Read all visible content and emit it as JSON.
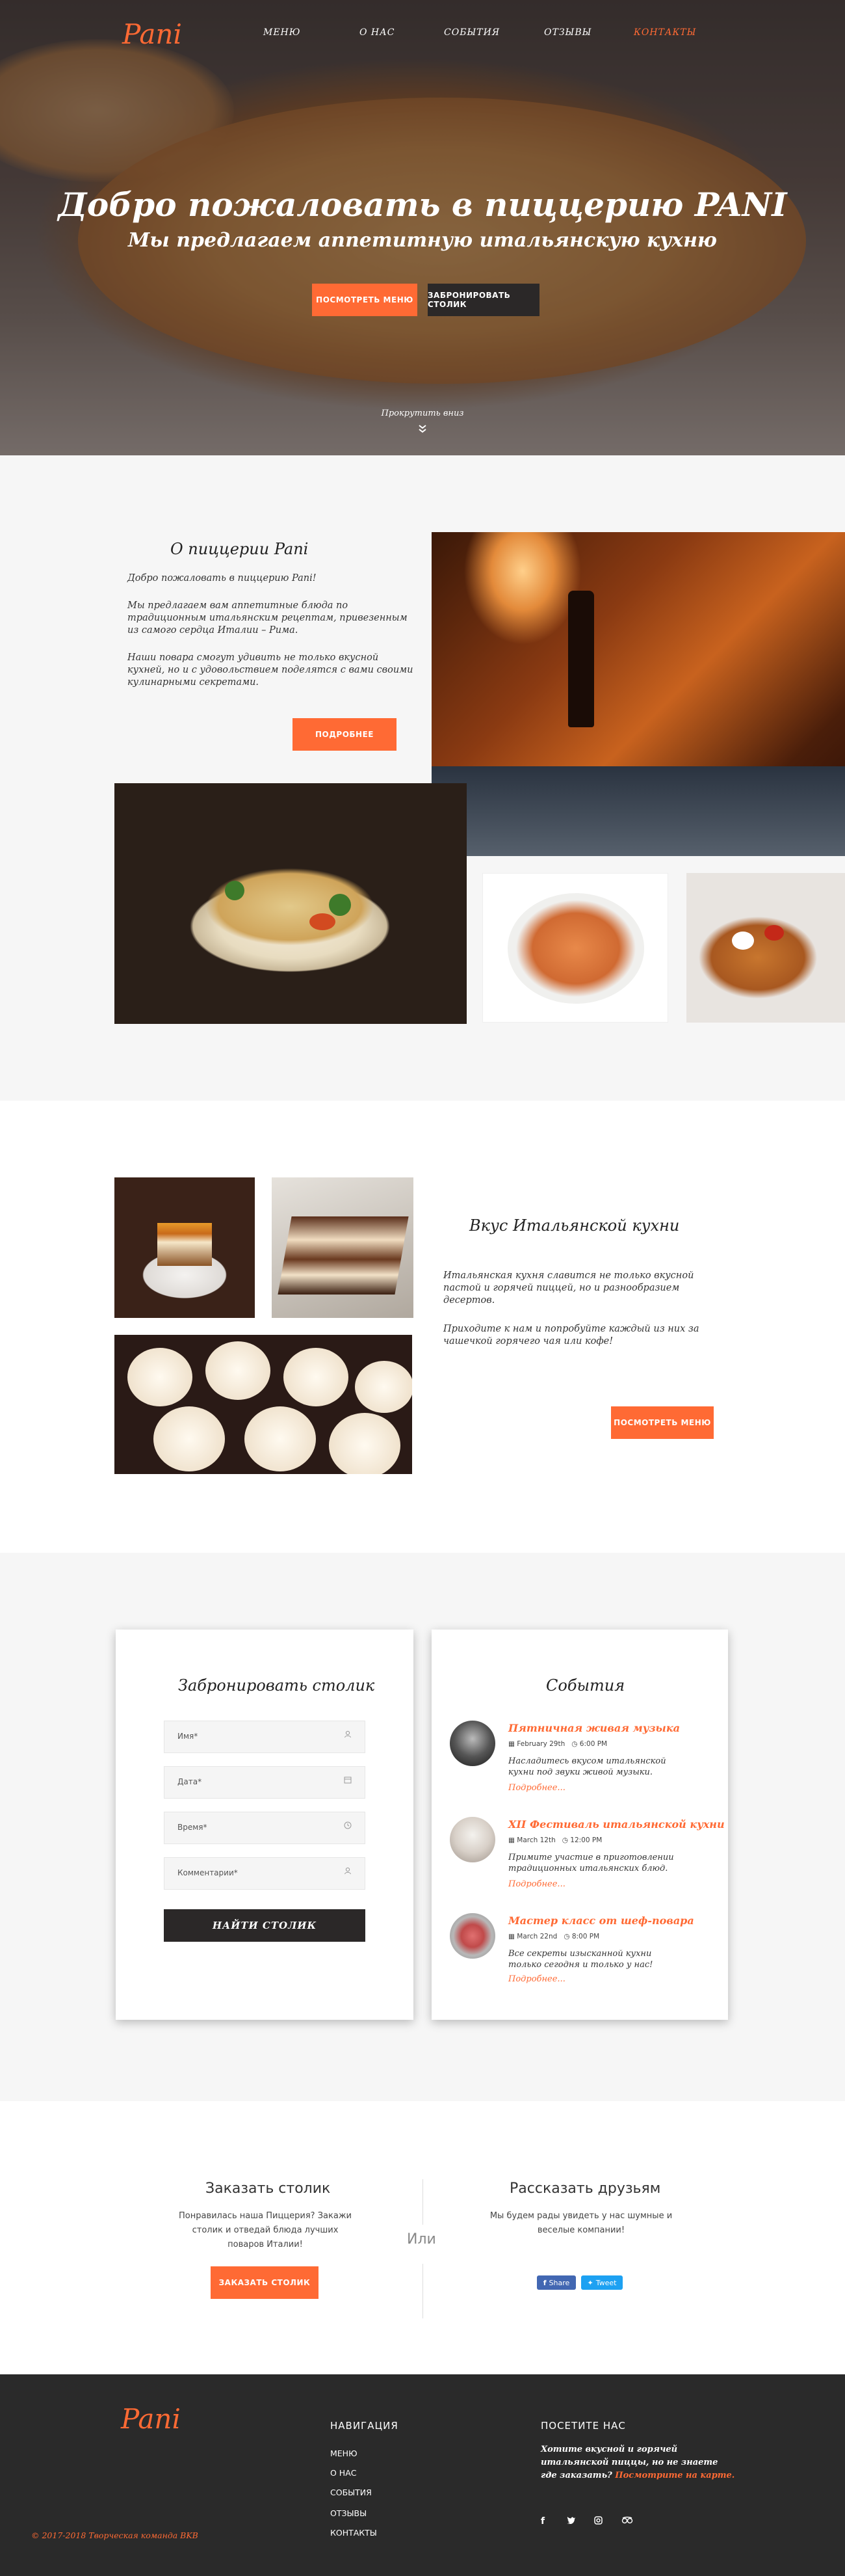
{
  "brand": {
    "logo": "Pani",
    "accent": "#ff6a34",
    "dark": "#2b2828"
  },
  "nav": {
    "items": [
      "МЕНЮ",
      "О НАС",
      "СОБЫТИЯ",
      "ОТЗЫВЫ",
      "КОНТАКТЫ"
    ]
  },
  "hero": {
    "title": "Добро пожаловать в пиццерию PANI",
    "subtitle": "Мы предлагаем аппетитную итальянскую кухню",
    "menu_button": "ПОСМОТРЕТЬ МЕНЮ",
    "book_button": "ЗАБРОНИРОВАТЬ СТОЛИК",
    "scroll": "Прокрутить вниз"
  },
  "about": {
    "title": "О пиццерии Pani",
    "p1": "Добро пожаловать в пиццерию Pani!",
    "p2": "Мы предлагаем вам аппетитные блюда по традиционным итальянским рецептам, привезенным из самого сердца Италии – Рима.",
    "p3": "Наши повара смогут удивить не только вкусной кухней, но и с удовольствием поделятся с вами своими кулинарными секретами.",
    "button": "ПОДРОБНЕЕ"
  },
  "dessert": {
    "title": "Вкус Итальянской кухни",
    "p1": "Итальянская кухня славится не только вкусной пастой и горячей пиццей, но и разнообразием десертов.",
    "p2": "Приходите к нам и попробуйте каждый из них за чашечкой горячего чая или кофе!",
    "button": "ПОСМОТРЕТЬ МЕНЮ"
  },
  "booking": {
    "title": "Забронировать столик",
    "fields": [
      {
        "placeholder": "Имя*",
        "icon": "user-icon"
      },
      {
        "placeholder": "Дата*",
        "icon": "calendar-icon"
      },
      {
        "placeholder": "Время*",
        "icon": "clock-icon"
      },
      {
        "placeholder": "Комментарии*",
        "icon": "user-icon"
      }
    ],
    "submit": "НАЙТИ СТОЛИК"
  },
  "events": {
    "title": "События",
    "items": [
      {
        "title": "Пятничная живая музыка",
        "date": "February 29th",
        "time": "6:00 PM",
        "text": "Насладитесь вкусом итальянской кухни под звуки живой музыки.",
        "more": "Подробнее..."
      },
      {
        "title": "XII Фестиваль итальянской кухни",
        "date": "March 12th",
        "time": "12:00 PM",
        "text": "Примите участие в приготовлении традиционных итальянских блюд.",
        "more": "Подробнее..."
      },
      {
        "title": "Мастер класс от шеф-повара",
        "date": "March 22nd",
        "time": "8:00 PM",
        "text": "Все секреты изысканной кухни только сегодня и только у нас!",
        "more": "Подробнее..."
      }
    ]
  },
  "share": {
    "left_title": "Заказать столик",
    "left_text": "Понравилась наша Пиццерия? Закажи столик и отведай блюда лучших поваров Италии!",
    "left_button": "ЗАКАЗАТЬ СТОЛИК",
    "or": "Или",
    "right_title": "Рассказать друзьям",
    "right_text": "Мы будем рады увидеть у нас шумные и веселые компании!",
    "fb": "Share",
    "tw": "Tweet"
  },
  "footer": {
    "logo": "Pani",
    "copyright": "© 2017-2018 Творческая команда BKB",
    "nav_title": "НАВИГАЦИЯ",
    "nav_items": [
      "МЕНЮ",
      "О НАС",
      "СОБЫТИЯ",
      "ОТЗЫВЫ",
      "КОНТАКТЫ"
    ],
    "visit_title": "ПОСЕТИТЕ НАС",
    "visit_text": "Хотите вкусной и горячей итальянской пиццы, но не знаете где заказать?",
    "visit_link": "Посмотрите на карте.",
    "social": [
      "facebook-icon",
      "twitter-icon",
      "instagram-icon",
      "tripadvisor-icon"
    ]
  }
}
